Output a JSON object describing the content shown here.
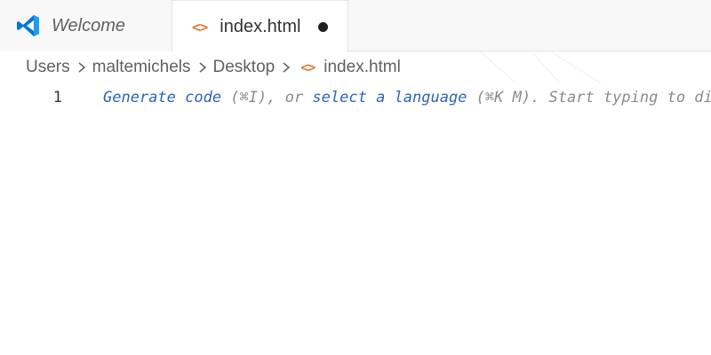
{
  "tabs": [
    {
      "label": "Welcome",
      "icon": "vscode-logo-icon",
      "active": false
    },
    {
      "label": "index.html",
      "icon": "html-file-icon",
      "glyph": "<>",
      "active": true,
      "unsaved": true
    }
  ],
  "breadcrumb": {
    "items": [
      "Users",
      "maltemichels",
      "Desktop",
      "index.html"
    ],
    "file_glyph": "<>"
  },
  "editor": {
    "line_number": "1",
    "hint": {
      "generate_code": "Generate code",
      "shortcut_1": " (⌘I), or ",
      "select_language": "select a language",
      "shortcut_2": " (⌘K M). Start typing to dismiss or don't show this again."
    }
  },
  "colors": {
    "vscode_blue": "#0078d4",
    "html_orange": "#e37933",
    "link_blue": "#2e63b8",
    "hint_gray": "#8b8b8b"
  }
}
